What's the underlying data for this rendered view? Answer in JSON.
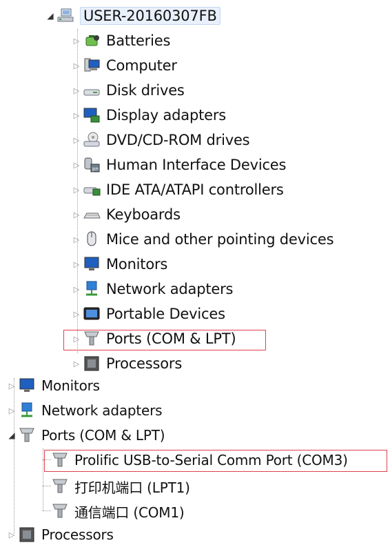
{
  "upper_tree": {
    "root": {
      "label": "USER-20160307FB",
      "icon": "computer-network-icon"
    },
    "items": [
      {
        "label": "Batteries",
        "icon": "battery-icon"
      },
      {
        "label": "Computer",
        "icon": "computer-icon"
      },
      {
        "label": "Disk drives",
        "icon": "disk-drive-icon"
      },
      {
        "label": "Display adapters",
        "icon": "display-adapter-icon"
      },
      {
        "label": "DVD/CD-ROM drives",
        "icon": "dvd-drive-icon"
      },
      {
        "label": "Human Interface Devices",
        "icon": "hid-icon"
      },
      {
        "label": "IDE ATA/ATAPI controllers",
        "icon": "ide-controller-icon"
      },
      {
        "label": "Keyboards",
        "icon": "keyboard-icon"
      },
      {
        "label": "Mice and other pointing devices",
        "icon": "mouse-icon"
      },
      {
        "label": "Monitors",
        "icon": "monitor-icon"
      },
      {
        "label": "Network adapters",
        "icon": "network-adapter-icon"
      },
      {
        "label": "Portable Devices",
        "icon": "portable-device-icon"
      },
      {
        "label": "Ports (COM & LPT)",
        "icon": "port-icon",
        "highlighted": true
      },
      {
        "label": "Processors",
        "icon": "processor-icon"
      }
    ]
  },
  "lower_tree": {
    "items": [
      {
        "label": "Monitors",
        "icon": "monitor-icon",
        "expanded": false
      },
      {
        "label": "Network adapters",
        "icon": "network-adapter-icon",
        "expanded": false
      },
      {
        "label": "Ports (COM & LPT)",
        "icon": "port-icon",
        "expanded": true,
        "children": [
          {
            "label": "Prolific USB-to-Serial Comm Port (COM3)",
            "icon": "port-icon",
            "highlighted": true
          },
          {
            "label": "打印机端口 (LPT1)",
            "icon": "port-icon"
          },
          {
            "label": "通信端口 (COM1)",
            "icon": "port-icon"
          }
        ]
      },
      {
        "label": "Processors",
        "icon": "processor-icon",
        "expanded": false
      }
    ]
  },
  "colors": {
    "highlight_border": "#e0404a",
    "root_selection": "#e8f0fb"
  }
}
